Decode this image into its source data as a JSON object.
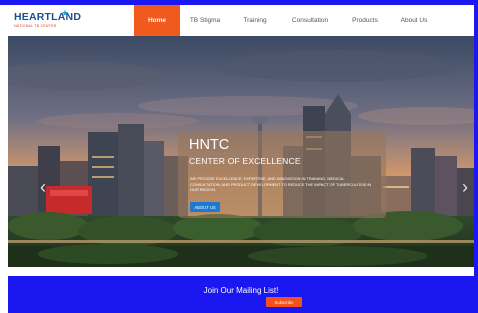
{
  "logo": {
    "name": "HEARTLAND",
    "tagline": "NATIONAL TB CENTER",
    "icon": "star-icon"
  },
  "nav": {
    "items": [
      {
        "label": "Home",
        "active": true
      },
      {
        "label": "TB Stigma",
        "active": false
      },
      {
        "label": "Training",
        "active": false
      },
      {
        "label": "Consultation",
        "active": false
      },
      {
        "label": "Products",
        "active": false
      },
      {
        "label": "About Us",
        "active": false
      }
    ]
  },
  "hero": {
    "title": "HNTC",
    "subtitle": "CENTER OF EXCELLENCE",
    "description": "We provide excellence, expertise, and innovation in training, medical consultation, and product development to reduce the impact of tuberculosis in our region.",
    "button_label": "ABOUT US",
    "prev_icon": "chevron-left-icon",
    "next_icon": "chevron-right-icon"
  },
  "mailing": {
    "text": "Join Our Mailing List!",
    "button_label": "Subscribe"
  },
  "colors": {
    "nav_active": "#f25a1d",
    "mailing_bg": "#1a17f0",
    "about_button": "#1c7ad2",
    "subscribe_button": "#f2501d"
  }
}
